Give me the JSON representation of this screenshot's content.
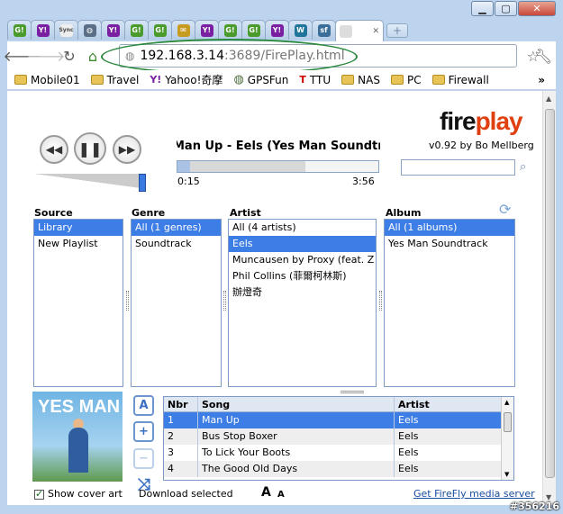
{
  "browser": {
    "tabs": [
      {
        "icon": "g-icon",
        "color": "#4a9a2c",
        "glyph": "G!"
      },
      {
        "icon": "yahoo-icon",
        "color": "#7b1fa2",
        "glyph": "Y!"
      },
      {
        "icon": "sync-icon",
        "color": "#888888",
        "glyph": "Sync"
      },
      {
        "icon": "globe-icon",
        "color": "#5a6f86",
        "glyph": "◍"
      },
      {
        "icon": "yahoo-icon",
        "color": "#7b1fa2",
        "glyph": "Y!"
      },
      {
        "icon": "g-icon",
        "color": "#4a9a2c",
        "glyph": "G!"
      },
      {
        "icon": "g-icon",
        "color": "#4a9a2c",
        "glyph": "G!"
      },
      {
        "icon": "mail-icon",
        "color": "#c79a20",
        "glyph": "✉"
      },
      {
        "icon": "yahoo-icon",
        "color": "#7b1fa2",
        "glyph": "Y!"
      },
      {
        "icon": "g-icon",
        "color": "#4a9a2c",
        "glyph": "G!"
      },
      {
        "icon": "g-icon",
        "color": "#4a9a2c",
        "glyph": "G!"
      },
      {
        "icon": "yahoo-icon",
        "color": "#7b1fa2",
        "glyph": "Y!"
      },
      {
        "icon": "wordpress-icon",
        "color": "#21759b",
        "glyph": "W"
      },
      {
        "icon": "sf-icon",
        "color": "#3b6e99",
        "glyph": "sf"
      }
    ],
    "url_host": "192.168.3.14",
    "url_path": ":3689/FirePlay.html",
    "bookmarks": [
      {
        "label": "Mobile01",
        "icon": "folder-icon"
      },
      {
        "label": "Travel",
        "icon": "folder-icon"
      },
      {
        "label": "Yahoo!奇摩",
        "icon": "yahoo-icon"
      },
      {
        "label": "GPSFun",
        "icon": "globe-icon"
      },
      {
        "label": "TTU",
        "icon": "ttu-icon"
      },
      {
        "label": "NAS",
        "icon": "folder-icon"
      },
      {
        "label": "PC",
        "icon": "folder-icon"
      },
      {
        "label": "Firewall",
        "icon": "folder-icon"
      }
    ],
    "more_bookmarks": "»"
  },
  "player": {
    "logo_part1": "fire",
    "logo_part2": "play",
    "version": "v0.92 by Bo Mellberg",
    "now_playing": "Man Up - Eels (Yes Man Soundtrack)",
    "elapsed": "0:15",
    "duration": "3:56",
    "progress_fraction": 0.064,
    "volume_fraction": 0.95
  },
  "panels": {
    "source": {
      "header": "Source",
      "items": [
        "Library",
        "New Playlist"
      ],
      "selected": 0
    },
    "genre": {
      "header": "Genre",
      "items": [
        "All (1 genres)",
        "Soundtrack"
      ],
      "selected": 0
    },
    "artist": {
      "header": "Artist",
      "items": [
        "All (4 artists)",
        "Eels",
        "Muncausen by Proxy (feat. Z",
        "Phil Collins (菲爾柯林斯)",
        "辦燈奇"
      ],
      "selected": 1
    },
    "album": {
      "header": "Album",
      "items": [
        "All (1 albums)",
        "Yes Man Soundtrack"
      ],
      "selected": 0
    }
  },
  "cover": {
    "title": "YES MAN"
  },
  "songs": {
    "headers": {
      "nbr": "Nbr",
      "song": "Song",
      "artist": "Artist"
    },
    "rows": [
      {
        "nbr": "1",
        "song": "Man Up",
        "artist": "Eels"
      },
      {
        "nbr": "2",
        "song": "Bus Stop Boxer",
        "artist": "Eels"
      },
      {
        "nbr": "3",
        "song": "To Lick Your Boots",
        "artist": "Eels"
      },
      {
        "nbr": "4",
        "song": "The Good Old Days",
        "artist": "Eels"
      }
    ],
    "selected": 0
  },
  "bottom": {
    "show_cover_art": "Show cover art",
    "download_selected": "Download selected",
    "font_big": "A",
    "font_small": "A",
    "get_firefly": "Get FireFly media server"
  },
  "watermark": "#356216"
}
